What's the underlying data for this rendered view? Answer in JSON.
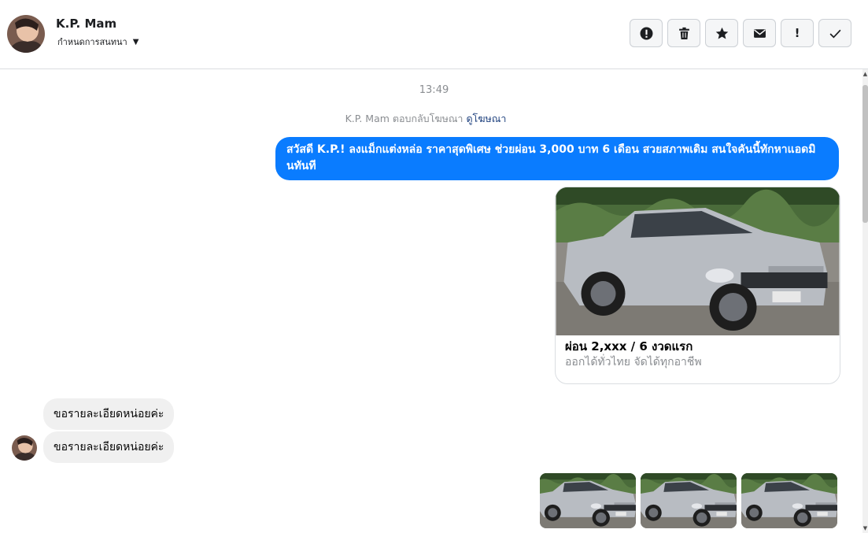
{
  "header": {
    "name": "K.P. Mam",
    "subtitle": "กำหนดการสนทนา"
  },
  "toolbar": {
    "icons": [
      "alert-circle-icon",
      "trash-icon",
      "star-icon",
      "envelope-icon",
      "exclamation-icon",
      "check-icon"
    ],
    "exclamation_glyph": "!"
  },
  "thread": {
    "timestamp": "13:49",
    "notice_text": "K.P. Mam ตอบกลับโฆษณา",
    "notice_link": "ดูโฆษณา",
    "outgoing_message": "สวัสดี K.P.! ลงแม็กแต่งหล่อ ราคาสุดพิเศษ ช่วยผ่อน 3,000 บาท 6 เดือน สวยสภาพเดิม สนใจคันนี้ทักหาแอดมินทันที",
    "ad_card": {
      "title": "ผ่อน 2,xxx / 6 งวดแรก",
      "subtitle": "ออกได้ทั่วไทย จัดได้ทุกอาชีพ"
    },
    "incoming_messages": [
      "ขอรายละเอียดหน่อยค่ะ",
      "ขอรายละเอียดหน่อยค่ะ"
    ]
  },
  "colors": {
    "accent": "#0a7cff",
    "incoming_bubble": "#f0f0f0",
    "meta_text": "#8a8d91"
  }
}
